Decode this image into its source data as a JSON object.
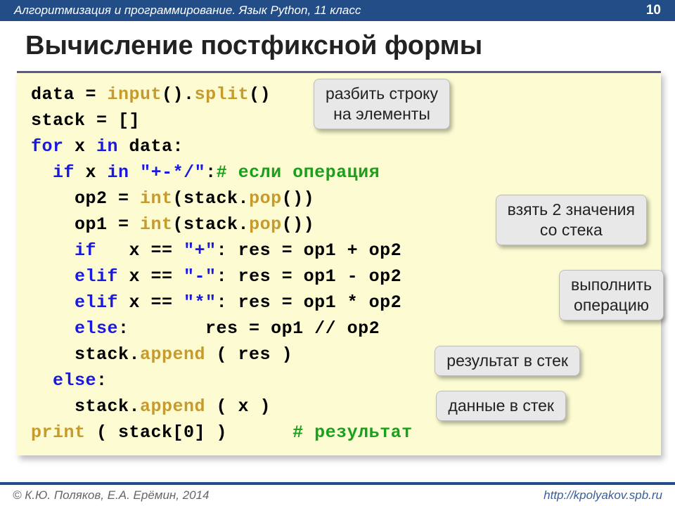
{
  "header": {
    "course": "Алгоритмизация и программирование. Язык Python, 11 класс",
    "page": "10"
  },
  "title": "Вычисление постфиксной формы",
  "code": {
    "l1a": "data = ",
    "l1b": "input",
    "l1c": "().",
    "l1d": "split",
    "l1e": "()",
    "l2": "stack = []",
    "l3a": "for",
    "l3b": " x ",
    "l3c": "in",
    "l3d": " data:",
    "l4a": "  ",
    "l4b": "if",
    "l4c": " x ",
    "l4d": "in",
    "l4e": " ",
    "l4f": "\"+-*/\"",
    "l4g": ":",
    "l4h": "# если операция",
    "l5a": "    op2 = ",
    "l5b": "int",
    "l5c": "(stack.",
    "l5d": "pop",
    "l5e": "())",
    "l6a": "    op1 = ",
    "l6b": "int",
    "l6c": "(stack.",
    "l6d": "pop",
    "l6e": "())",
    "l7a": "    ",
    "l7b": "if",
    "l7c": "   x == ",
    "l7d": "\"+\"",
    "l7e": ": res = op1 + op2",
    "l8a": "    ",
    "l8b": "elif",
    "l8c": " x == ",
    "l8d": "\"-\"",
    "l8e": ": res = op1 - op2",
    "l9a": "    ",
    "l9b": "elif",
    "l9c": " x == ",
    "l9d": "\"*\"",
    "l9e": ": res = op1 * op2",
    "l10a": "    ",
    "l10b": "else",
    "l10c": ":       res = op1 // op2",
    "l11a": "    stack.",
    "l11b": "append",
    "l11c": " ( res )",
    "l12a": "  ",
    "l12b": "else",
    "l12c": ":",
    "l13a": "    stack.",
    "l13b": "append",
    "l13c": " ( x )",
    "l14a": "print",
    "l14b": " ( stack[0] )      ",
    "l14c": "# результат"
  },
  "callouts": {
    "c1": "разбить строку\nна элементы",
    "c2": "взять 2 значения\nсо стека",
    "c3": "выполнить\nоперацию",
    "c4": "результат в стек",
    "c5": "данные в стек"
  },
  "footer": {
    "copyright": "© К.Ю. Поляков, Е.А. Ерёмин, 2014",
    "url": "http://kpolyakov.spb.ru"
  }
}
